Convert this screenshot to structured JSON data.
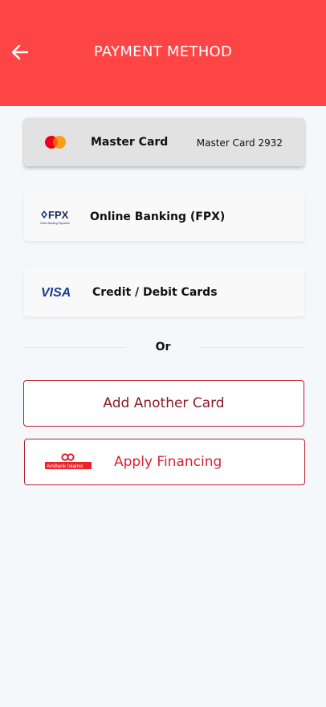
{
  "header": {
    "title": "PAYMENT METHOD",
    "back_icon": "arrow-left-icon",
    "background_color": "#fe4545"
  },
  "payment_methods": [
    {
      "label": "Master Card",
      "detail": "Master Card 2932",
      "icon": "mastercard-logo",
      "selected": true
    },
    {
      "label": "Online Banking (FPX)",
      "logo_text": "FPX",
      "logo_subtext": "Online Banking Payments",
      "icon": "fpx-logo",
      "selected": false
    },
    {
      "label": "Credit / Debit Cards",
      "logo_text": "VISA",
      "icon": "visa-logo",
      "selected": false
    }
  ],
  "separator": {
    "text": "Or"
  },
  "actions": {
    "add_card_label": "Add Another Card",
    "apply_financing_label": "Apply Financing",
    "financing_logo_text": "AmBank Islamic",
    "accent_color": "#d6232f"
  }
}
